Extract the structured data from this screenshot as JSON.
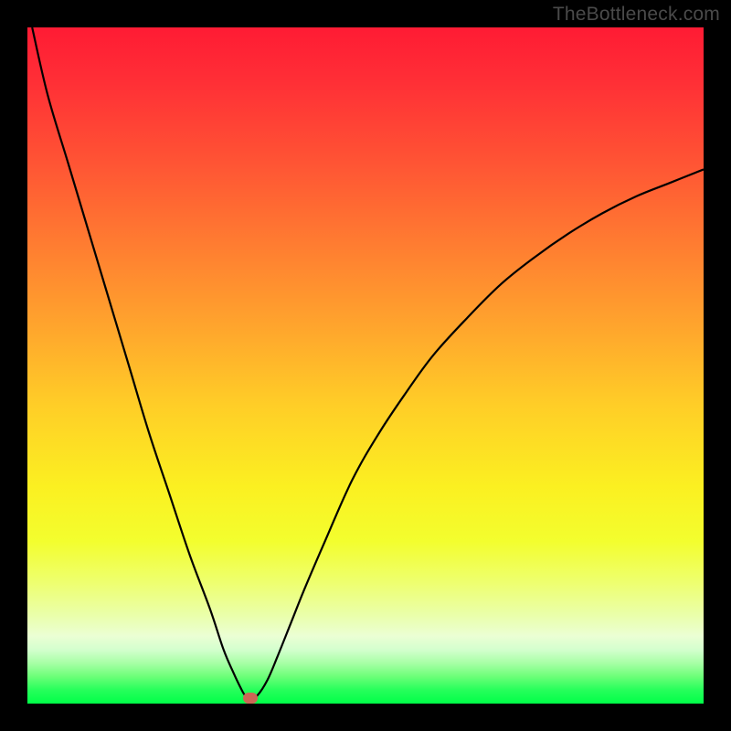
{
  "credit_text": "TheBottleneck.com",
  "marker": {
    "x_pct": 33.0,
    "y_pct": 99.2,
    "color": "#cc6655"
  },
  "chart_data": {
    "type": "line",
    "title": "",
    "xlabel": "",
    "ylabel": "",
    "xlim": [
      0,
      100
    ],
    "ylim": [
      0,
      100
    ],
    "grid": false,
    "series": [
      {
        "name": "curve",
        "x": [
          0.7,
          3,
          6,
          9,
          12,
          15,
          18,
          21,
          24,
          27,
          29,
          30.5,
          31.5,
          32.2,
          33.0,
          34.0,
          35.5,
          37,
          39,
          41,
          44,
          48,
          52,
          56,
          60,
          65,
          70,
          75,
          80,
          85,
          90,
          95,
          100
        ],
        "y": [
          100,
          90,
          80,
          70,
          60,
          50,
          40,
          31,
          22,
          14,
          8,
          4.5,
          2.4,
          1.2,
          0.8,
          1.2,
          3.5,
          7,
          12,
          17,
          24,
          33,
          40,
          46,
          51.5,
          57,
          62,
          66,
          69.5,
          72.5,
          75,
          77,
          79
        ]
      }
    ],
    "annotations": [
      {
        "type": "marker",
        "x": 33.0,
        "y": 0.8,
        "color": "#cc6655"
      }
    ],
    "background_gradient": {
      "stops": [
        {
          "pct": 0,
          "color": "#ff1b34"
        },
        {
          "pct": 50,
          "color": "#ffce27"
        },
        {
          "pct": 90,
          "color": "#ebffd4"
        },
        {
          "pct": 100,
          "color": "#00ff48"
        }
      ]
    }
  }
}
